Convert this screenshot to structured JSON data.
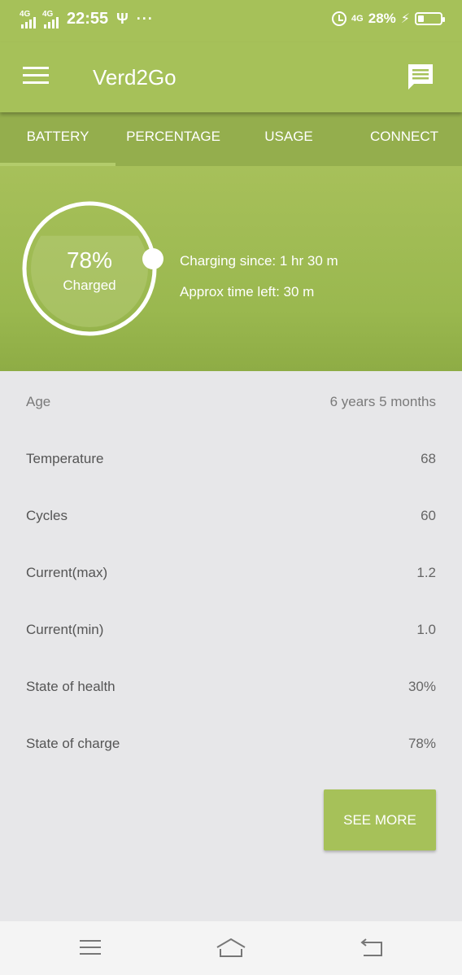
{
  "status_bar": {
    "signal1": "4G",
    "signal2": "4G",
    "time": "22:55",
    "usb_symbol": "Ψ",
    "more_symbol": "···",
    "network": "4G",
    "battery_percent": "28%",
    "battery_level": 0.28,
    "icons": [
      "signal-icon",
      "usb-icon",
      "more-icon",
      "alarm-icon",
      "charging-icon",
      "battery-icon"
    ]
  },
  "app_bar": {
    "title": "Verd2Go",
    "icons": [
      "menu-icon",
      "chat-icon"
    ]
  },
  "tabs": [
    {
      "label": "BATTERY",
      "active": true
    },
    {
      "label": "PERCENTAGE",
      "active": false
    },
    {
      "label": "USAGE",
      "active": false
    },
    {
      "label": "CONNECT",
      "active": false
    }
  ],
  "charge": {
    "percent_text": "78%",
    "percent_value": 78,
    "status": "Charged",
    "charging_since": "Charging since: 1 hr 30 m",
    "time_left": "Approx time left: 30 m"
  },
  "details": [
    {
      "label": "Age",
      "value": "6 years 5 months"
    },
    {
      "label": "Temperature",
      "value": "68"
    },
    {
      "label": "Cycles",
      "value": "60"
    },
    {
      "label": "Current(max)",
      "value": "1.2"
    },
    {
      "label": "Current(min)",
      "value": "1.0"
    },
    {
      "label": "State of health",
      "value": "30%"
    },
    {
      "label": "State of charge",
      "value": "78%"
    }
  ],
  "see_more_label": "SEE MORE",
  "nav_bar": {
    "icons": [
      "recents-icon",
      "home-icon",
      "back-icon"
    ]
  },
  "colors": {
    "primary": "#a6c159",
    "primary_dark": "#94ae4d",
    "background": "#e7e7e9"
  }
}
